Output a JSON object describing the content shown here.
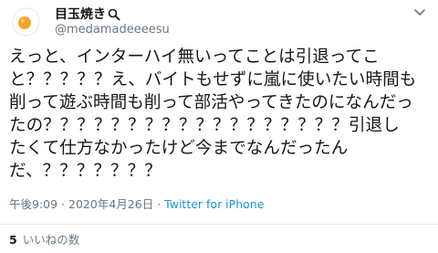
{
  "author": {
    "display_name": "目玉焼き",
    "handle": "@medamadeeeesu",
    "avatar_icon": "fried-egg-icon",
    "name_badge_icon": "magnifying-glass-icon"
  },
  "tweet": {
    "text_lines": [
      "えっと、インターハイ無いってことは引退ってこ",
      "と？？？？？え、バイトもせずに嵐に使いたい時間も",
      "削って遊ぶ時間も削って部活やってきたのになんだっ",
      "たの？？？？？？？？？？？？？？？？？？引退し",
      "たくて仕方なかったけど今までなんだったん",
      "だ、？？？？？？？"
    ],
    "time": "午後9:09",
    "separator": "·",
    "date": "2020年4月26日",
    "source": "Twitter for iPhone"
  },
  "stats": {
    "likes_count": "5",
    "likes_label": "いいねの数"
  },
  "colors": {
    "text": "#14171a",
    "secondary": "#657786",
    "link": "#1b95e0",
    "divider": "#e6ecf0"
  }
}
